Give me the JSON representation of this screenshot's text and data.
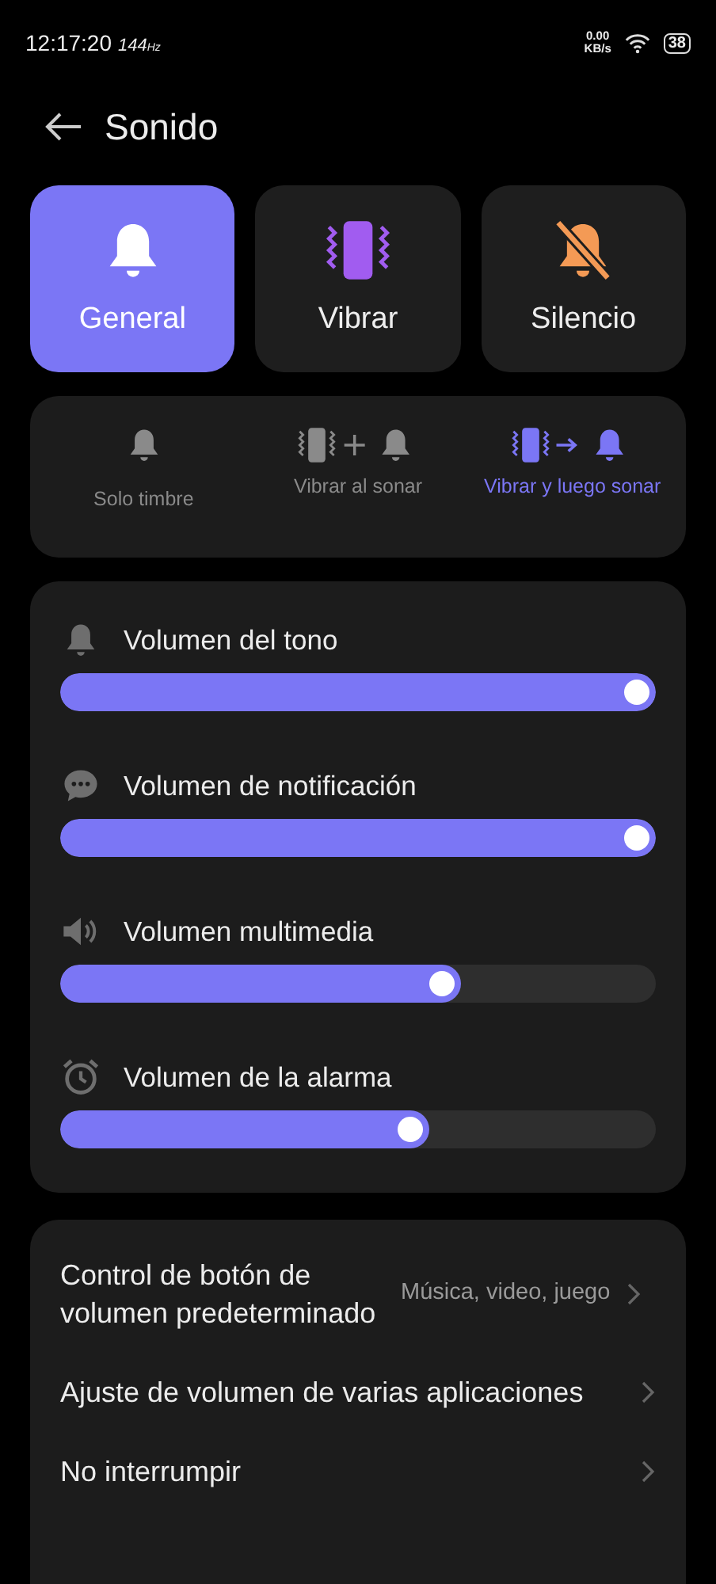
{
  "status_bar": {
    "time": "12:17:20",
    "refresh_rate": "144",
    "refresh_unit": "Hz",
    "net_speed": "0.00",
    "net_unit": "KB/s",
    "battery": "38"
  },
  "header": {
    "title": "Sonido"
  },
  "modes": [
    {
      "kind": "general",
      "label": "General",
      "selected": true
    },
    {
      "kind": "vibrate",
      "label": "Vibrar",
      "selected": false
    },
    {
      "kind": "silent",
      "label": "Silencio",
      "selected": false
    }
  ],
  "ring_options": [
    {
      "kind": "ring",
      "label": "Solo timbre",
      "selected": false
    },
    {
      "kind": "vibrate_ring",
      "label": "Vibrar al sonar",
      "selected": false
    },
    {
      "kind": "vibrate_then_ring",
      "label": "Vibrar y luego sonar",
      "selected": true
    }
  ],
  "volumes": [
    {
      "kind": "ringtone",
      "label": "Volumen del tono",
      "level": 1.0
    },
    {
      "kind": "notification",
      "label": "Volumen de notificación",
      "level": 1.0
    },
    {
      "kind": "media",
      "label": "Volumen multimedia",
      "level": 0.65
    },
    {
      "kind": "alarm",
      "label": "Volumen de la alarma",
      "level": 0.595
    }
  ],
  "settings": [
    {
      "title": "Control de botón de volumen predeterminado",
      "value": "Música, video, juego"
    },
    {
      "title": "Ajuste de volumen de varias aplicaciones"
    },
    {
      "title": "No interrumpir"
    }
  ]
}
